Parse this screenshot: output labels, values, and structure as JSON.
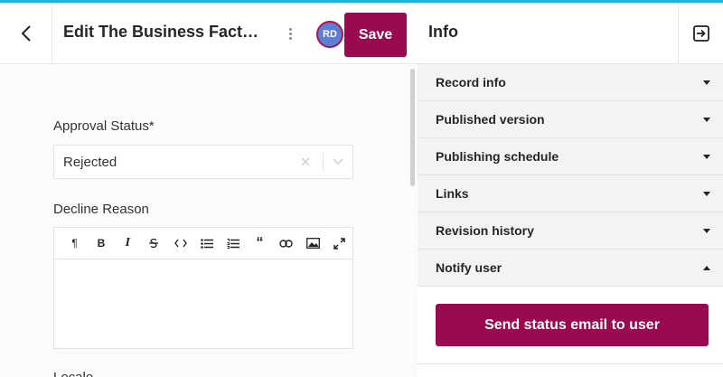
{
  "header": {
    "title": "Edit The Business Factory",
    "avatar_initials": "RD",
    "save_label": "Save"
  },
  "form": {
    "approval_status": {
      "label": "Approval Status*",
      "value": "Rejected"
    },
    "decline_reason": {
      "label": "Decline Reason",
      "toolbar": [
        "paragraph",
        "bold",
        "italic",
        "strikethrough",
        "code",
        "bulleted-list",
        "numbered-list",
        "quote",
        "link",
        "image",
        "fullscreen"
      ]
    },
    "locale_label": "Locale"
  },
  "info_panel": {
    "title": "Info",
    "sections": [
      {
        "label": "Record info",
        "expanded": false
      },
      {
        "label": "Published version",
        "expanded": false
      },
      {
        "label": "Publishing schedule",
        "expanded": false
      },
      {
        "label": "Links",
        "expanded": false
      },
      {
        "label": "Revision history",
        "expanded": false
      },
      {
        "label": "Notify user",
        "expanded": true
      }
    ],
    "send_email_label": "Send status email to user"
  },
  "colors": {
    "accent": "#990a4e",
    "top_bar": "#1fb2dc",
    "avatar": "#5b7fd6"
  }
}
